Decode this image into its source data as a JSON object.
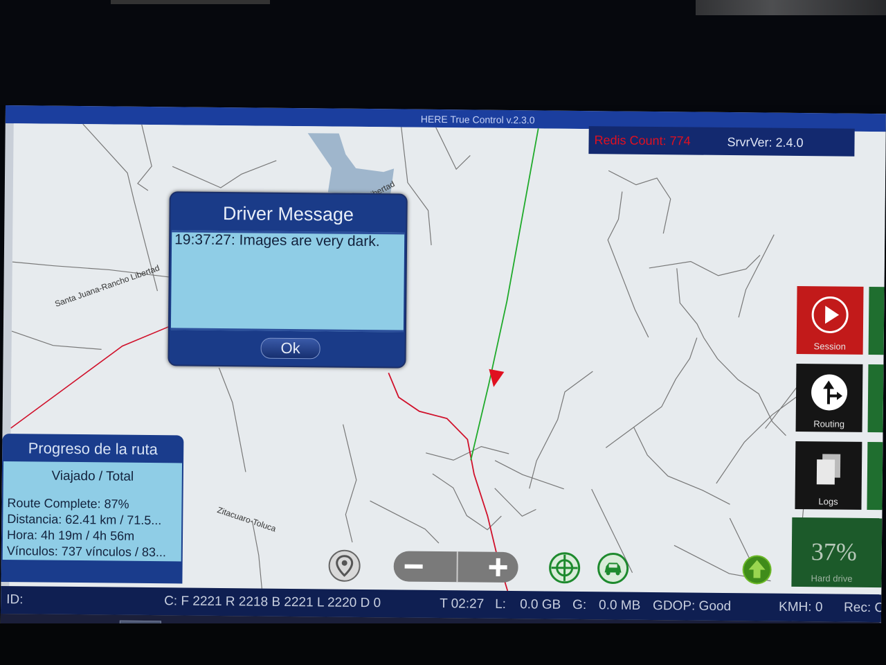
{
  "app": {
    "title": "HERE True Control v.2.3.0"
  },
  "server": {
    "redis_count": "Redis Count: 774",
    "server_version": "SrvrVer: 2.4.0"
  },
  "map": {
    "places": [
      "Santa Juana-Rancho Libertad",
      "Zitacuaro-Toluca",
      "o Libertad"
    ]
  },
  "dialog": {
    "title": "Driver Message",
    "message": "19:37:27: Images are very dark.",
    "ok_label": "Ok"
  },
  "progress": {
    "title": "Progreso de la ruta",
    "subtitle": "Viajado / Total",
    "route_complete": "Route Complete: 87%",
    "distance": "Distancia: 62.41 km / 71.5...",
    "time": "Hora: 4h 19m / 4h 56m",
    "links": "Vínculos: 737 vínculos / 83..."
  },
  "side_buttons": {
    "session": "Session",
    "routing": "Routing",
    "logs": "Logs",
    "hard_drive_pct": "37%",
    "hard_drive_label": "Hard drive",
    "colors": {
      "session": "#c21a1a",
      "routing": "#151515",
      "logs": "#151515",
      "hard_drive": "#1c5a2a"
    }
  },
  "map_controls": {
    "icons": [
      "location-pin-icon",
      "zoom-out-icon",
      "zoom-in-icon",
      "crosshair-icon",
      "car-recenter-icon",
      "north-arrow-icon"
    ]
  },
  "status": {
    "id": "ID:",
    "counters": "C: F 2221 R 2218 B 2221 L 2220 D 0",
    "t": "T 02:27",
    "l_label": "L:",
    "l_value": "0.0 GB",
    "g_label": "G:",
    "g_value": "0.0 MB",
    "gdop": "GDOP: Good",
    "kmh": "KMH: 0",
    "rec": "Rec: C"
  },
  "taskbar": {
    "icons": [
      "windows-start-icon",
      "internet-explorer-icon",
      "app-bird-icon",
      "true-control-car-icon",
      "keyboard-icon",
      "tray-icons"
    ]
  }
}
